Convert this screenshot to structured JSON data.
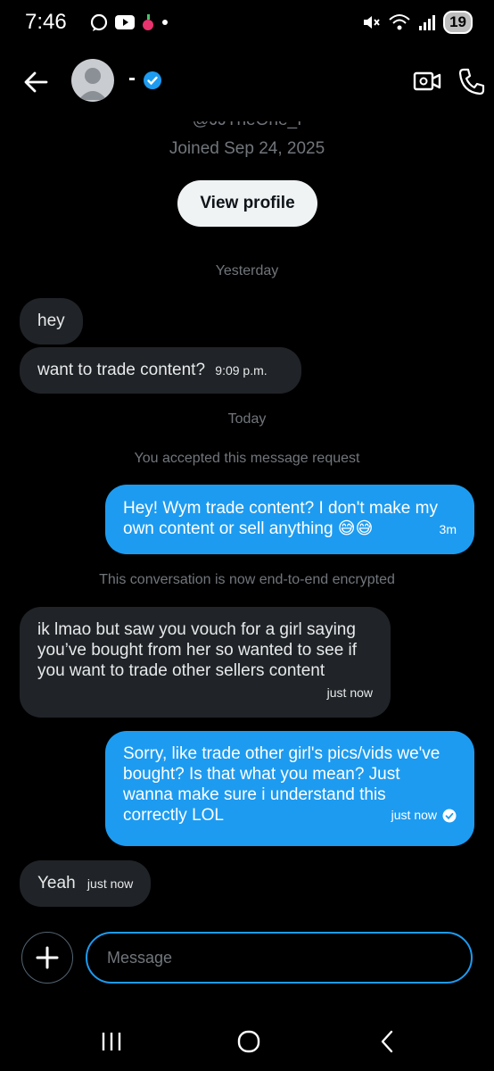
{
  "status_bar": {
    "time": "7:46",
    "battery": "19"
  },
  "header": {
    "name": "-",
    "handle": "@JJTheOne_I",
    "joined": "Joined Sep 24, 2025",
    "view_profile_label": "View profile"
  },
  "conversation": {
    "day_yesterday": "Yesterday",
    "msg1": "hey",
    "msg2": "want to trade content?",
    "msg2_time": "9:09 p.m.",
    "day_today": "Today",
    "accepted_notice": "You accepted this message request",
    "msg3_line1": "Hey! Wym trade content? I don't make my",
    "msg3_line2": "own content or sell anything 😅😅",
    "msg3_time": "3m",
    "encrypted_notice": "This conversation is now end-to-end encrypted",
    "msg4_line1": "ik lmao but saw you vouch for a girl saying",
    "msg4_line2": "you’ve bought from her so wanted to see if",
    "msg4_line3": "you want to trade other sellers content",
    "msg4_time": "just now",
    "msg5_line1": "Sorry, like trade other girl's pics/vids we've",
    "msg5_line2": "bought? Is that what you mean? Just",
    "msg5_line3": "wanna make sure i understand this",
    "msg5_line4": "correctly LOL",
    "msg5_time": "just now",
    "msg6": "Yeah",
    "msg6_time": "just now"
  },
  "composer": {
    "placeholder": "Message"
  },
  "colors": {
    "accent": "#1d9bf0",
    "incoming_bubble": "#202327",
    "background": "#000000",
    "muted": "#71767b"
  }
}
